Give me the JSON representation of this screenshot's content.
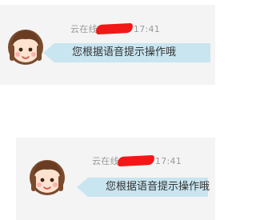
{
  "messages": [
    {
      "sender_prefix": "云在线",
      "time": "17:41",
      "text": "您根据语音提示操作哦",
      "avatar_icon": "cartoon-girl-avatar-icon"
    },
    {
      "sender_prefix": "云在线",
      "time": "17:41",
      "text": "您根据语音提示操作哦",
      "avatar_icon": "cartoon-girl-avatar-icon"
    }
  ],
  "colors": {
    "card_background": "#f4f4f4",
    "bubble_background": "#c8e5f0",
    "redaction": "#f21818",
    "meta_text": "#9a9a9a"
  }
}
